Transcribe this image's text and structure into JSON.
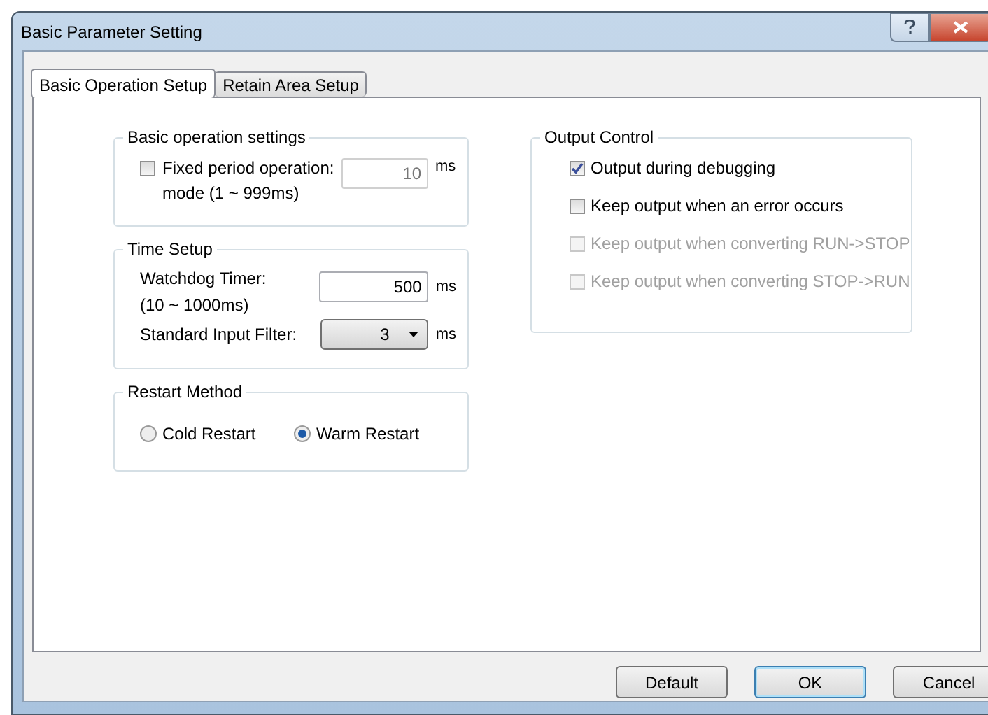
{
  "window": {
    "title": "Basic Parameter Setting"
  },
  "tabs": [
    {
      "label": "Basic Operation Setup",
      "selected": true
    },
    {
      "label": "Retain Area Setup",
      "selected": false
    }
  ],
  "basic_operation": {
    "title": "Basic operation settings",
    "fixed_period": {
      "label": "Fixed period operation:",
      "sublabel": "mode (1 ~ 999ms)",
      "checked": false,
      "value": "10",
      "disabled": true,
      "unit": "ms"
    }
  },
  "time_setup": {
    "title": "Time Setup",
    "watchdog": {
      "label": "Watchdog Timer:",
      "sublabel": "(10 ~ 1000ms)",
      "value": "500",
      "unit": "ms"
    },
    "input_filter": {
      "label": "Standard Input Filter:",
      "value": "3",
      "unit": "ms"
    }
  },
  "restart": {
    "title": "Restart Method",
    "options": [
      {
        "label": "Cold Restart",
        "selected": false
      },
      {
        "label": "Warm Restart",
        "selected": true
      }
    ]
  },
  "output_control": {
    "title": "Output Control",
    "items": [
      {
        "label": "Output during debugging",
        "checked": true,
        "disabled": false
      },
      {
        "label": "Keep output when an error occurs",
        "checked": false,
        "disabled": false
      },
      {
        "label": "Keep output when converting RUN->STOP",
        "checked": false,
        "disabled": true
      },
      {
        "label": "Keep output when converting STOP->RUN",
        "checked": false,
        "disabled": true
      }
    ]
  },
  "buttons": [
    {
      "label": "Default",
      "default": false
    },
    {
      "label": "OK",
      "default": true
    },
    {
      "label": "Cancel",
      "default": false
    }
  ]
}
